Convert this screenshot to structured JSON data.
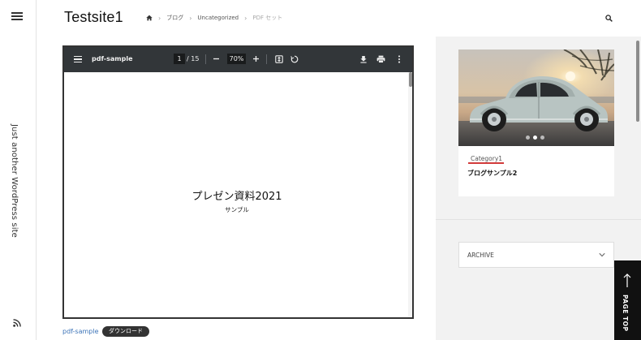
{
  "site": {
    "title": "Testsite1",
    "tagline": "Just another WordPress site"
  },
  "breadcrumb": {
    "items": [
      "ブログ",
      "Uncategorized"
    ],
    "current": "PDF セット"
  },
  "pdf_viewer": {
    "filename": "pdf-sample",
    "current_page": "1",
    "total_pages": "/ 15",
    "zoom": "70%",
    "page_title": "プレゼン資料2021",
    "page_subtitle": "サンプル"
  },
  "file": {
    "link_label": "pdf-sample",
    "download_label": "ダウンロード"
  },
  "sidebar": {
    "post": {
      "category": "Category1",
      "title": "ブログサンプル2"
    },
    "archive_label": "ARCHIVE"
  },
  "pagetop_label": "PAGE TOP",
  "colors": {
    "accent_underline": "#d23b3b",
    "link": "#3d74b8",
    "pdf_toolbar": "#323639",
    "pagetop_bg": "#111111"
  },
  "icons": [
    "hamburger-menu-icon",
    "home-icon",
    "search-icon",
    "rss-icon",
    "download-icon",
    "print-icon",
    "more-vert-icon",
    "fit-page-icon",
    "rotate-icon",
    "chevron-down-icon",
    "arrow-up-icon"
  ]
}
